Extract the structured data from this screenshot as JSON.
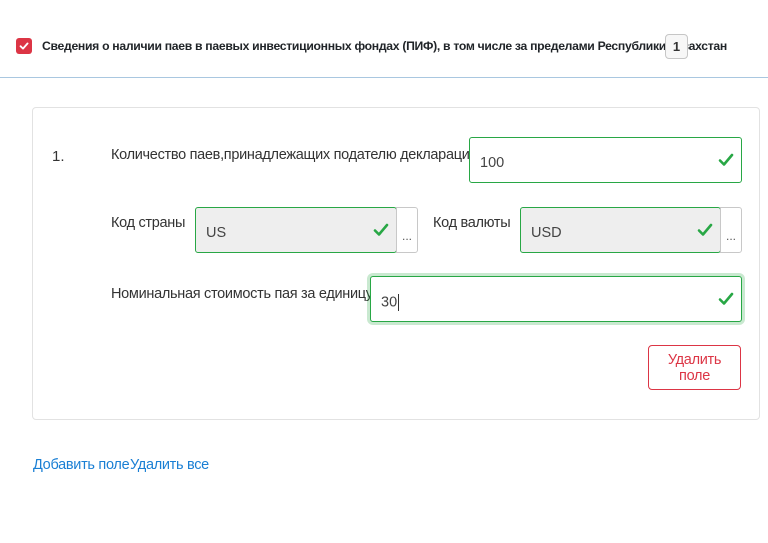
{
  "section": {
    "title": "Сведения о наличии паев в паевых инвестиционных фондах (ПИФ), в том числе за пределами Республики Казахстан",
    "count": "1",
    "checkbox_color": "#dc3545"
  },
  "item": {
    "number": "1.",
    "shares": {
      "label": "Количество паев,принадлежащих подателю декларации",
      "value": "100"
    },
    "country": {
      "label": "Код страны",
      "value": "US",
      "picker": "..."
    },
    "currency": {
      "label": "Код валюты",
      "value": "USD",
      "picker": "..."
    },
    "nominal": {
      "label": "Номинальная стоимость пая за единицу",
      "value": "30"
    },
    "delete_label": "Удалить поле"
  },
  "actions": {
    "add_label": "Добавить поле",
    "delete_all_label": "Удалить все"
  },
  "colors": {
    "valid": "#28a745",
    "danger": "#dc3545",
    "link": "#1a7fd4"
  },
  "icons": {
    "valid": "check-icon",
    "header": "checked-checkbox-icon"
  }
}
